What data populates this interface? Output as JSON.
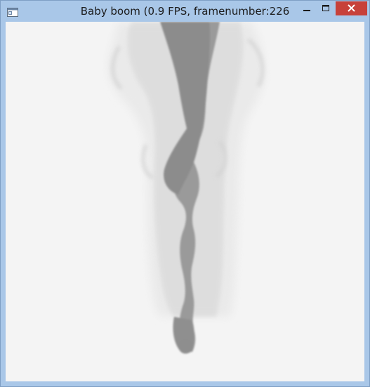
{
  "window": {
    "title": "Baby boom (0.9 FPS, framenumber:226",
    "icons": {
      "app": "window-app-icon",
      "minimize": "minimize-icon",
      "maximize": "maximize-icon",
      "close": "close-icon"
    },
    "colors": {
      "frame": "#a9c7e8",
      "close_button": "#c7413a",
      "canvas_background": "#f4f4f4",
      "smoke_dark": "#8a8a8a",
      "smoke_light": "#d4d4d4"
    }
  }
}
